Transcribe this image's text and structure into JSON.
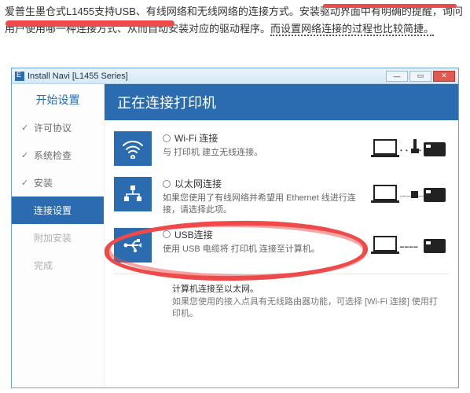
{
  "intro": {
    "part1": "爱普生墨仓式L1455支持USB、有线网络和无线网络的连接方式。",
    "highlight": "安装驱动界面中有明确的提醒",
    "part2": "，询问用户使用哪一种连接方式、从而自动安装对应的驱动程序。",
    "underlined": "而设置网络连接的过程也比较简捷。"
  },
  "window": {
    "title": "Install Navi [L1455 Series]"
  },
  "sidebar": {
    "header": "开始设置",
    "items": [
      {
        "label": "许可协议",
        "status": "done"
      },
      {
        "label": "系统检查",
        "status": "done"
      },
      {
        "label": "安装",
        "status": "done"
      },
      {
        "label": "连接设置",
        "status": "active"
      },
      {
        "label": "附加安装",
        "status": "pending"
      },
      {
        "label": "完成",
        "status": "pending"
      }
    ]
  },
  "main": {
    "heading": "正在连接打印机"
  },
  "options": [
    {
      "id": "wifi",
      "title": "Wi-Fi 连接",
      "desc": "与 打印机 建立无线连接。"
    },
    {
      "id": "ethernet",
      "title": "以太网连接",
      "desc": "如果您使用了有线网络并希望用 Ethernet 线进行连接，请选择此项。"
    },
    {
      "id": "usb",
      "title": "USB连接",
      "desc": "使用 USB 电缆将 打印机 连接至计算机。"
    }
  ],
  "footer": {
    "title": "计算机连接至以太网。",
    "desc": "如果您使用的接入点具有无线路由器功能，可选择 [Wi-Fi 连接] 使用打印机。"
  }
}
